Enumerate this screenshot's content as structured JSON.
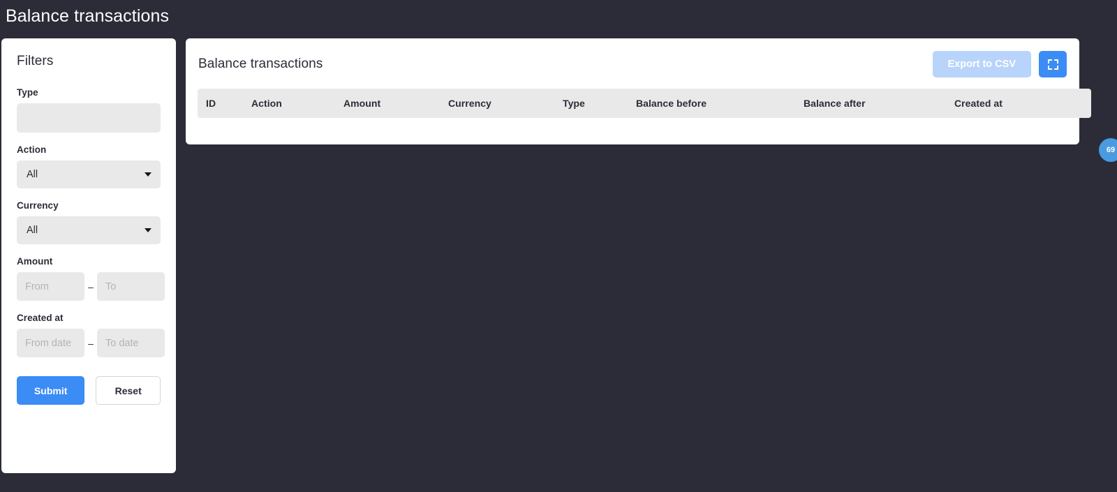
{
  "page": {
    "title": "Balance transactions"
  },
  "filters": {
    "heading": "Filters",
    "type": {
      "label": "Type",
      "value": "",
      "placeholder": ""
    },
    "action": {
      "label": "Action",
      "value": "All",
      "arrow_icon": "chevron-down-icon"
    },
    "currency": {
      "label": "Currency",
      "value": "All",
      "arrow_icon": "chevron-down-icon"
    },
    "amount": {
      "label": "Amount",
      "from_value": "",
      "from_placeholder": "From",
      "to_value": "",
      "to_placeholder": "To",
      "separator": "–"
    },
    "created_at": {
      "label": "Created at",
      "from_value": "",
      "from_placeholder": "From date",
      "to_value": "",
      "to_placeholder": "To date",
      "separator": "–"
    },
    "submit_label": "Submit",
    "reset_label": "Reset"
  },
  "table_panel": {
    "title": "Balance transactions",
    "export_label": "Export to CSV",
    "fullscreen_icon": "fullscreen-expand-icon",
    "columns": [
      "ID",
      "Action",
      "Amount",
      "Currency",
      "Type",
      "Balance before",
      "Balance after",
      "Created at"
    ],
    "rows": []
  },
  "edge_badge": {
    "value": "69"
  },
  "colors": {
    "background": "#2c2c38",
    "card": "#ffffff",
    "accent": "#3b8cf5",
    "accent_disabled": "#b8d4fb",
    "field": "#e9e9e9",
    "badge": "#4a9ae0"
  }
}
